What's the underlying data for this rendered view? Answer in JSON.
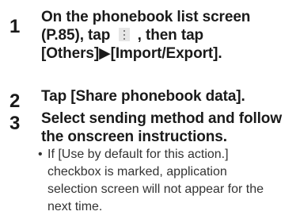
{
  "steps": [
    {
      "number": "1",
      "lines": [
        "On the phonebook list screen",
        "(P.85), tap",
        ", then tap",
        "[Others]▶[Import/Export]."
      ]
    },
    {
      "number": "2",
      "lines": [
        "Tap [Share phonebook data]."
      ]
    },
    {
      "number": "3",
      "lines": [
        "Select sending method and follow",
        "the onscreen instructions."
      ]
    }
  ],
  "note": {
    "bullet": "•",
    "lines": [
      "If [Use by default for this action.]",
      "checkbox is marked, application",
      "selection screen will not appear for the",
      "next time."
    ]
  },
  "icons": {
    "menu": "vertical-dots-menu-icon"
  }
}
